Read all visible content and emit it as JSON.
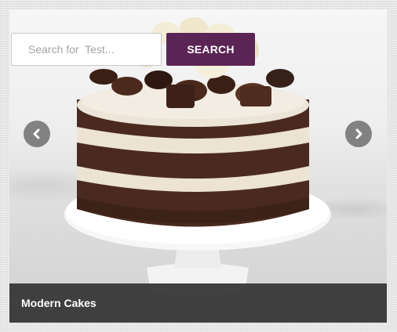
{
  "search": {
    "placeholder": "Search for  Test...",
    "button_label": "SEARCH"
  },
  "slider": {
    "caption": "Modern Cakes",
    "prev_icon": "chevron-left-icon",
    "next_icon": "chevron-right-icon"
  },
  "colors": {
    "search_button": "#5a2454",
    "caption_bar": "#323232",
    "nav_arrow": "#6e6e6e"
  }
}
